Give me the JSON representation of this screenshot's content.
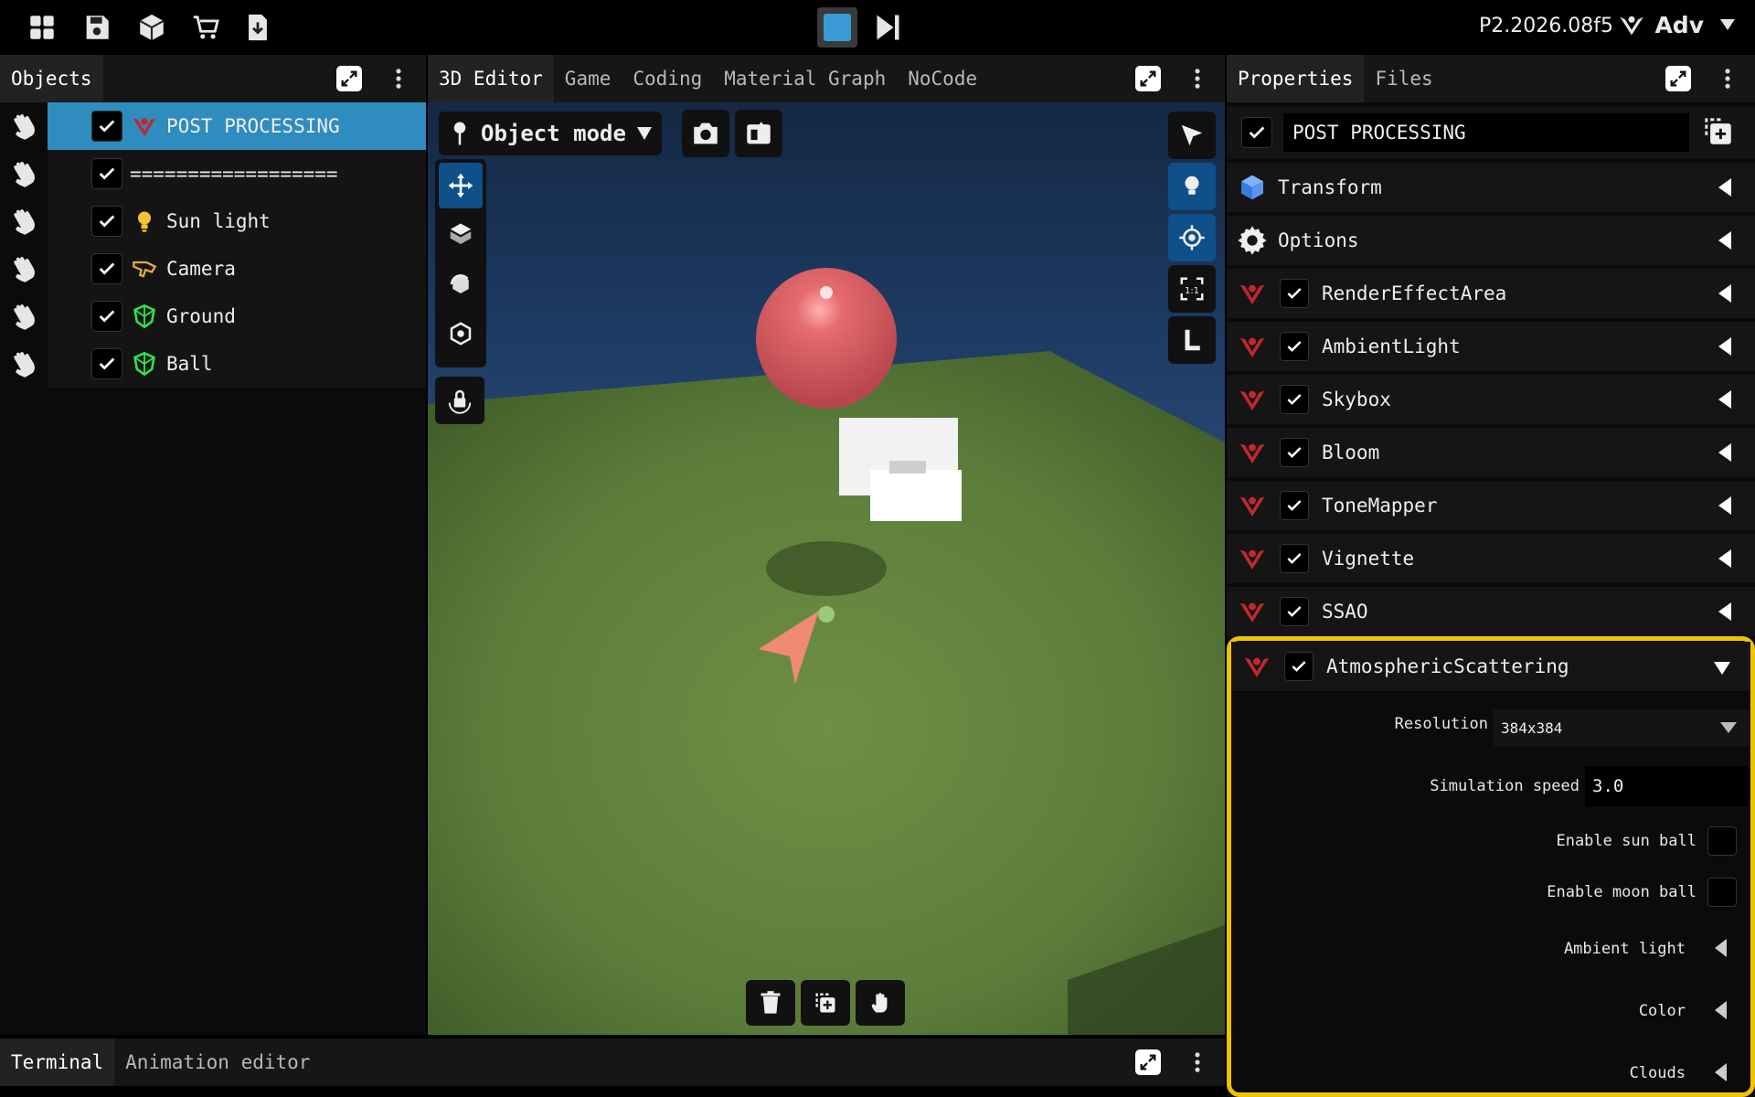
{
  "topbar": {
    "version": "P2.2026.08f5",
    "profile_label": "Adv",
    "left_icons": [
      "grid-icon",
      "save-icon",
      "cube-icon",
      "cart-icon",
      "download-icon"
    ]
  },
  "objects_panel": {
    "title": "Objects",
    "items": [
      {
        "label": "POST PROCESSING",
        "icon": "post-processing-icon",
        "selected": true
      },
      {
        "label": "==================",
        "icon": "",
        "selected": false
      },
      {
        "label": "Sun light",
        "icon": "lightbulb-icon",
        "selected": false
      },
      {
        "label": "Camera",
        "icon": "camera-icon",
        "selected": false
      },
      {
        "label": "Ground",
        "icon": "mesh-icon",
        "selected": false
      },
      {
        "label": "Ball",
        "icon": "mesh-icon",
        "selected": false
      }
    ]
  },
  "editor": {
    "tabs": [
      "3D Editor",
      "Game",
      "Coding",
      "Material Graph",
      "NoCode"
    ],
    "active_tab": "3D Editor",
    "mode_label": "Object mode"
  },
  "properties": {
    "tabs": [
      "Properties",
      "Files"
    ],
    "object_name": "POST PROCESSING",
    "sections": [
      {
        "label": "Transform",
        "icon": "cube-icon",
        "has_check": false
      },
      {
        "label": "Options",
        "icon": "gear-icon",
        "has_check": false
      },
      {
        "label": "RenderEffectArea",
        "icon": "post-processing-icon",
        "has_check": true
      },
      {
        "label": "AmbientLight",
        "icon": "post-processing-icon",
        "has_check": true
      },
      {
        "label": "Skybox",
        "icon": "post-processing-icon",
        "has_check": true
      },
      {
        "label": "Bloom",
        "icon": "post-processing-icon",
        "has_check": true
      },
      {
        "label": "ToneMapper",
        "icon": "post-processing-icon",
        "has_check": true
      },
      {
        "label": "Vignette",
        "icon": "post-processing-icon",
        "has_check": true
      },
      {
        "label": "SSAO",
        "icon": "post-processing-icon",
        "has_check": true
      },
      {
        "label": "AtmosphericScattering",
        "icon": "post-processing-icon",
        "has_check": true
      }
    ],
    "atmospheric": {
      "resolution_label": "Resolution",
      "resolution_value": "384x384",
      "sim_speed_label": "Simulation speed",
      "sim_speed_value": "3.0",
      "sun_ball_label": "Enable sun ball",
      "moon_ball_label": "Enable moon ball",
      "ambient_light_label": "Ambient light",
      "color_label": "Color",
      "clouds_label": "Clouds"
    },
    "highlight_color": "#f2c200"
  },
  "bottom": {
    "tabs": [
      "Terminal",
      "Animation editor"
    ]
  }
}
